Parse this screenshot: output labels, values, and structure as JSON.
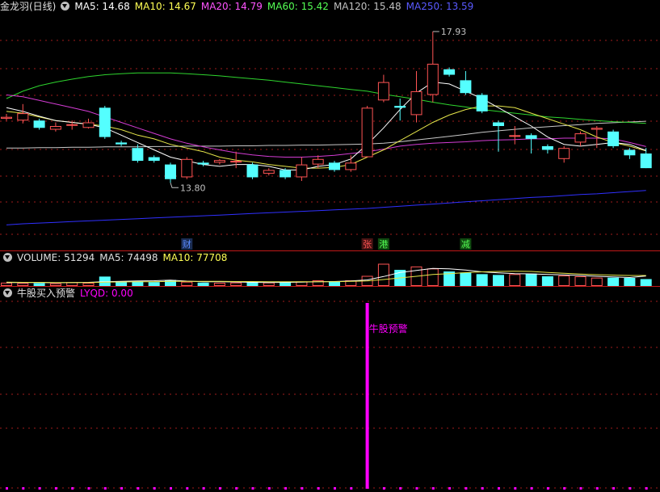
{
  "main_panel": {
    "stock_name": "金龙羽(日线)",
    "ma_items": [
      {
        "label": "MA5: 14.68",
        "color": "#ffffff"
      },
      {
        "label": "MA10: 14.67",
        "color": "#ffff54"
      },
      {
        "label": "MA20: 14.79",
        "color": "#ff54ff"
      },
      {
        "label": "MA60: 15.42",
        "color": "#54ff54"
      },
      {
        "label": "MA120: 15.48",
        "color": "#c0c0c0"
      },
      {
        "label": "MA250: 13.59",
        "color": "#4848ff"
      }
    ],
    "high_label": "17.93",
    "low_label": "13.80",
    "event_markers": [
      {
        "text": "财",
        "color": "#5a8cff",
        "bg": "#1a2c52",
        "bar": 11
      },
      {
        "text": "张",
        "color": "#ff5454",
        "bg": "#4a1414",
        "bar": 22
      },
      {
        "text": "港",
        "color": "#54ff54",
        "bg": "#104a10",
        "bar": 23
      },
      {
        "text": "减",
        "color": "#54ff54",
        "bg": "#104a10",
        "bar": 28
      }
    ]
  },
  "volume_panel": {
    "label": "VOLUME: 51294",
    "ma5_label": "MA5: 74498",
    "ma10_label": "MA10: 77708"
  },
  "indicator_panel": {
    "title": "牛股买入预警",
    "value_label": "LYQD: 0.00",
    "signal_text": "牛股预警",
    "signal_bar": 22
  },
  "colors": {
    "up": "#ff5454",
    "down": "#54ffff",
    "grid": "#a01c1c",
    "signal": "#ff00ff"
  },
  "chart_data": {
    "type": "candlestick",
    "candles": [
      {
        "o": 15.55,
        "c": 15.6,
        "h": 15.68,
        "l": 15.5
      },
      {
        "o": 15.5,
        "c": 15.7,
        "h": 15.95,
        "l": 15.42
      },
      {
        "o": 15.5,
        "c": 15.3,
        "h": 15.55,
        "l": 15.25
      },
      {
        "o": 15.25,
        "c": 15.35,
        "h": 15.45,
        "l": 15.2
      },
      {
        "o": 15.4,
        "c": 15.4,
        "h": 15.5,
        "l": 15.25
      },
      {
        "o": 15.3,
        "c": 15.45,
        "h": 15.55,
        "l": 15.28
      },
      {
        "o": 15.85,
        "c": 15.05,
        "h": 15.9,
        "l": 15.0
      },
      {
        "o": 14.9,
        "c": 14.85,
        "h": 14.95,
        "l": 14.8
      },
      {
        "o": 14.75,
        "c": 14.4,
        "h": 14.85,
        "l": 14.35
      },
      {
        "o": 14.5,
        "c": 14.4,
        "h": 14.55,
        "l": 14.35
      },
      {
        "o": 14.3,
        "c": 13.9,
        "h": 14.35,
        "l": 13.8
      },
      {
        "o": 13.95,
        "c": 14.45,
        "h": 14.5,
        "l": 13.9
      },
      {
        "o": 14.35,
        "c": 14.3,
        "h": 14.4,
        "l": 14.25
      },
      {
        "o": 14.35,
        "c": 14.42,
        "h": 14.45,
        "l": 14.3
      },
      {
        "o": 14.4,
        "c": 14.4,
        "h": 14.65,
        "l": 14.2
      },
      {
        "o": 14.3,
        "c": 13.95,
        "h": 14.35,
        "l": 13.9
      },
      {
        "o": 14.05,
        "c": 14.15,
        "h": 14.2,
        "l": 14.0
      },
      {
        "o": 14.15,
        "c": 13.95,
        "h": 14.2,
        "l": 13.9
      },
      {
        "o": 13.95,
        "c": 14.3,
        "h": 14.5,
        "l": 13.85
      },
      {
        "o": 14.3,
        "c": 14.45,
        "h": 14.55,
        "l": 14.2
      },
      {
        "o": 14.35,
        "c": 14.15,
        "h": 14.4,
        "l": 14.1
      },
      {
        "o": 14.15,
        "c": 14.35,
        "h": 14.55,
        "l": 14.1
      },
      {
        "o": 14.5,
        "c": 15.85,
        "h": 15.9,
        "l": 14.5
      },
      {
        "o": 16.05,
        "c": 16.55,
        "h": 16.75,
        "l": 16.0
      },
      {
        "o": 15.9,
        "c": 15.85,
        "h": 16.1,
        "l": 15.5
      },
      {
        "o": 15.65,
        "c": 16.3,
        "h": 16.85,
        "l": 15.45
      },
      {
        "o": 16.2,
        "c": 17.05,
        "h": 17.93,
        "l": 16.0
      },
      {
        "o": 16.9,
        "c": 16.75,
        "h": 16.95,
        "l": 16.7
      },
      {
        "o": 16.6,
        "c": 16.25,
        "h": 16.85,
        "l": 16.2
      },
      {
        "o": 16.2,
        "c": 15.75,
        "h": 16.25,
        "l": 15.7
      },
      {
        "o": 15.45,
        "c": 15.35,
        "h": 15.5,
        "l": 14.65
      },
      {
        "o": 15.1,
        "c": 15.1,
        "h": 15.35,
        "l": 14.85
      },
      {
        "o": 15.1,
        "c": 15.0,
        "h": 15.15,
        "l": 14.6
      },
      {
        "o": 14.8,
        "c": 14.7,
        "h": 14.85,
        "l": 14.6
      },
      {
        "o": 14.45,
        "c": 14.75,
        "h": 14.8,
        "l": 14.35
      },
      {
        "o": 14.9,
        "c": 15.15,
        "h": 15.2,
        "l": 14.8
      },
      {
        "o": 15.25,
        "c": 15.3,
        "h": 15.35,
        "l": 14.75
      },
      {
        "o": 15.2,
        "c": 14.8,
        "h": 15.25,
        "l": 14.75
      },
      {
        "o": 14.7,
        "c": 14.55,
        "h": 14.75,
        "l": 14.45
      },
      {
        "o": 14.6,
        "c": 14.2,
        "h": 14.75,
        "l": 14.2
      }
    ],
    "ma5": [
      15.85,
      15.75,
      15.62,
      15.5,
      15.45,
      15.4,
      15.3,
      15.1,
      14.9,
      14.7,
      14.5,
      14.4,
      14.3,
      14.25,
      14.3,
      14.3,
      14.25,
      14.15,
      14.15,
      14.25,
      14.3,
      14.45,
      14.85,
      15.3,
      15.8,
      16.25,
      16.55,
      16.5,
      16.3,
      16.1,
      15.85,
      15.6,
      15.35,
      15.05,
      14.85,
      14.8,
      14.85,
      14.9,
      14.85,
      14.68
    ],
    "ma10": [
      15.75,
      15.7,
      15.6,
      15.5,
      15.45,
      15.4,
      15.35,
      15.25,
      15.1,
      15.0,
      14.85,
      14.75,
      14.65,
      14.5,
      14.42,
      14.37,
      14.3,
      14.25,
      14.2,
      14.2,
      14.22,
      14.3,
      14.5,
      14.7,
      14.95,
      15.2,
      15.45,
      15.65,
      15.8,
      15.9,
      15.9,
      15.85,
      15.7,
      15.55,
      15.4,
      15.25,
      15.05,
      14.9,
      14.8,
      14.67
    ],
    "ma20": [
      16.2,
      16.15,
      16.05,
      15.95,
      15.85,
      15.75,
      15.6,
      15.45,
      15.3,
      15.15,
      15.0,
      14.88,
      14.78,
      14.7,
      14.62,
      14.56,
      14.52,
      14.5,
      14.5,
      14.52,
      14.55,
      14.6,
      14.65,
      14.72,
      14.8,
      14.85,
      14.88,
      14.9,
      14.92,
      14.95,
      14.97,
      14.98,
      15.0,
      15.0,
      15.02,
      15.02,
      15.02,
      15.0,
      14.9,
      14.79
    ],
    "ma60": [
      16.1,
      16.3,
      16.45,
      16.55,
      16.63,
      16.7,
      16.75,
      16.78,
      16.8,
      16.8,
      16.8,
      16.78,
      16.75,
      16.72,
      16.68,
      16.64,
      16.6,
      16.55,
      16.5,
      16.45,
      16.4,
      16.35,
      16.3,
      16.22,
      16.15,
      16.08,
      16.0,
      15.93,
      15.87,
      15.8,
      15.75,
      15.7,
      15.65,
      15.6,
      15.57,
      15.53,
      15.5,
      15.47,
      15.45,
      15.42
    ],
    "ma120": [
      14.75,
      14.75,
      14.76,
      14.76,
      14.77,
      14.77,
      14.78,
      14.78,
      14.78,
      14.79,
      14.79,
      14.8,
      14.8,
      14.8,
      14.81,
      14.81,
      14.82,
      14.82,
      14.83,
      14.83,
      14.84,
      14.85,
      14.86,
      14.88,
      14.92,
      14.97,
      15.02,
      15.07,
      15.12,
      15.18,
      15.22,
      15.26,
      15.3,
      15.33,
      15.36,
      15.39,
      15.42,
      15.44,
      15.46,
      15.48
    ],
    "ma250": [
      12.65,
      12.68,
      12.7,
      12.72,
      12.74,
      12.76,
      12.78,
      12.8,
      12.82,
      12.84,
      12.86,
      12.88,
      12.9,
      12.92,
      12.94,
      12.96,
      12.98,
      13.0,
      13.02,
      13.04,
      13.06,
      13.08,
      13.1,
      13.13,
      13.16,
      13.19,
      13.22,
      13.25,
      13.28,
      13.31,
      13.34,
      13.37,
      13.4,
      13.42,
      13.45,
      13.48,
      13.5,
      13.53,
      13.56,
      13.59
    ],
    "volume": [
      25000,
      22000,
      21000,
      20000,
      28000,
      24000,
      70000,
      34000,
      35000,
      29000,
      45000,
      32000,
      25000,
      24000,
      26000,
      30000,
      26000,
      28000,
      34000,
      42000,
      36000,
      42000,
      75000,
      165000,
      120000,
      145000,
      130000,
      108000,
      100000,
      88000,
      82000,
      88000,
      92000,
      72000,
      78000,
      72000,
      62000,
      62000,
      60000,
      51294
    ],
    "vol_ma5": [
      26000,
      26000,
      25000,
      24000,
      25000,
      27000,
      32000,
      35000,
      38000,
      39000,
      43000,
      36000,
      32000,
      32000,
      30000,
      27000,
      26000,
      27000,
      29000,
      32000,
      33000,
      37000,
      45000,
      70000,
      100000,
      115000,
      130000,
      128000,
      118000,
      105000,
      98000,
      92000,
      90000,
      85000,
      82000,
      78000,
      72000,
      68000,
      63000,
      74498
    ],
    "vol_ma10": [
      28000,
      27000,
      27000,
      26000,
      26000,
      26000,
      28000,
      30000,
      31000,
      32000,
      34000,
      35000,
      35000,
      34000,
      33000,
      33000,
      31000,
      31000,
      31000,
      31000,
      32000,
      34000,
      37000,
      48000,
      60000,
      72000,
      85000,
      92000,
      99000,
      105000,
      108000,
      110000,
      108000,
      100000,
      94000,
      88000,
      84000,
      81000,
      78000,
      77708
    ],
    "lyqd": [
      0,
      0,
      0,
      0,
      0,
      0,
      0,
      0,
      0,
      0,
      0,
      0,
      0,
      0,
      0,
      0,
      0,
      0,
      0,
      0,
      0,
      0,
      1,
      0,
      0,
      0,
      0,
      0,
      0,
      0,
      0,
      0,
      0,
      0,
      0,
      0,
      0,
      0,
      0,
      0
    ]
  }
}
